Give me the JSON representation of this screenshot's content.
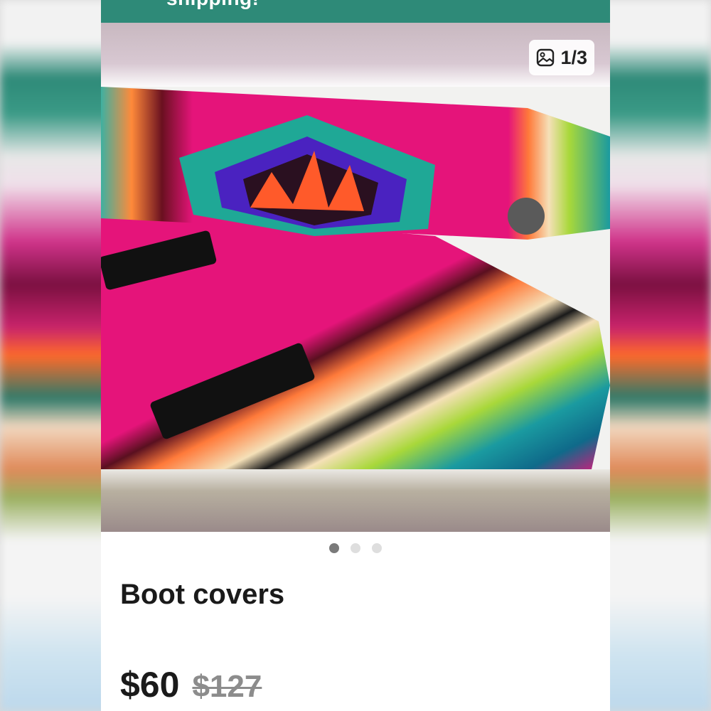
{
  "banner": {
    "text": "shipping!"
  },
  "gallery": {
    "counter": "1/3",
    "dots": [
      {
        "active": true
      },
      {
        "active": false
      },
      {
        "active": false
      }
    ]
  },
  "listing": {
    "title": "Boot covers",
    "price": "$60",
    "original_price": "$127"
  },
  "colors": {
    "banner": "#2e8a78",
    "text": "#1a1a1a",
    "strikethrough": "#8c8c8c"
  }
}
